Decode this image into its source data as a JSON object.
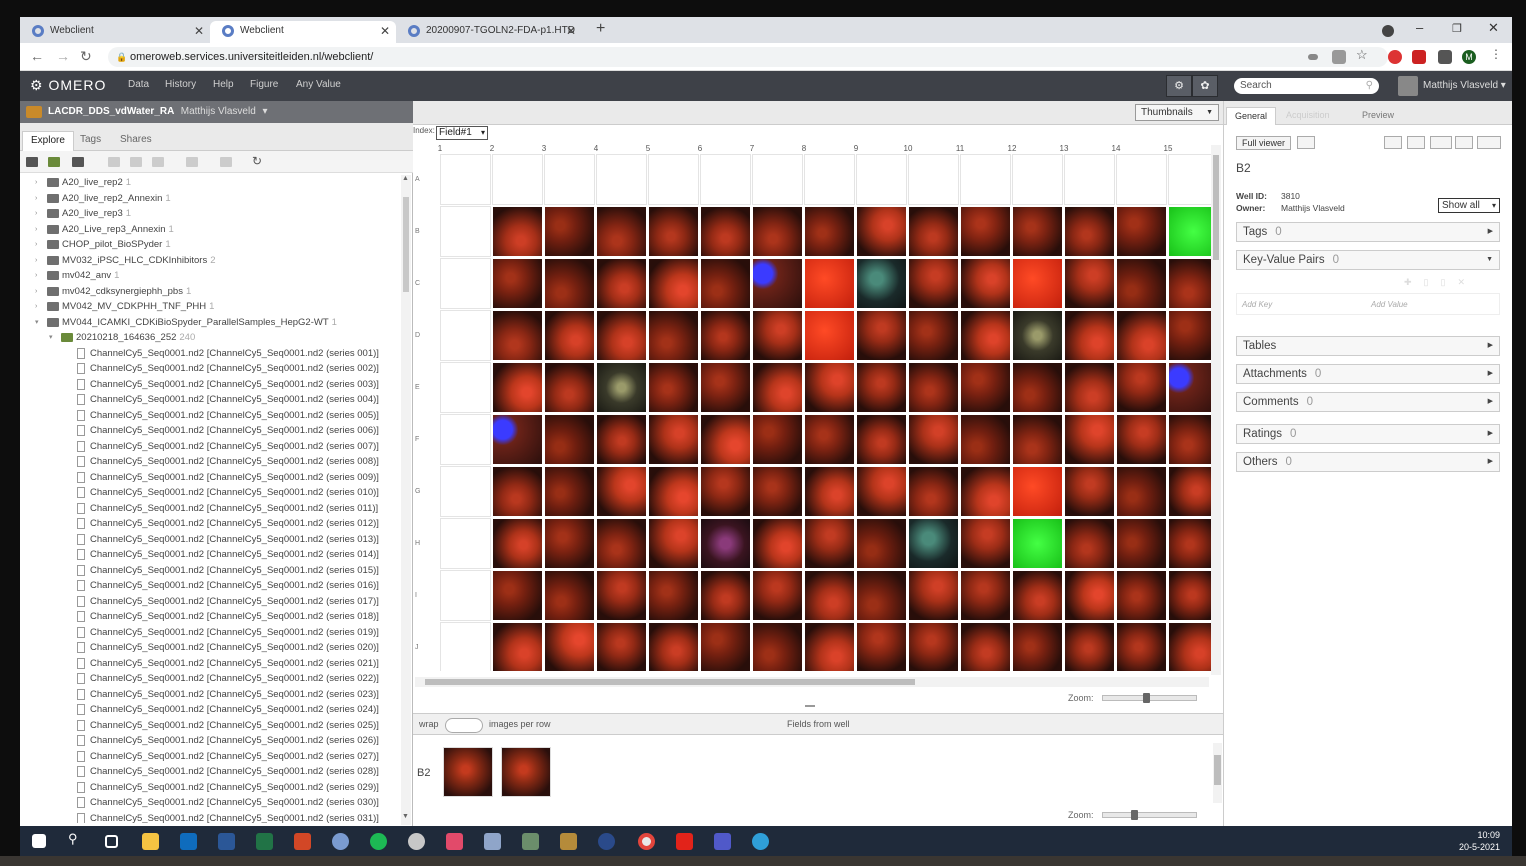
{
  "browser": {
    "tabs": [
      {
        "title": "Webclient",
        "active": false
      },
      {
        "title": "Webclient",
        "active": true
      },
      {
        "title": "20200907-TGOLN2-FDA-p1.HTD",
        "active": false
      }
    ],
    "url": "omeroweb.services.universiteitleiden.nl/webclient/"
  },
  "app": {
    "logo": "OMERO",
    "menu": [
      "Data",
      "History",
      "Help",
      "Figure",
      "Any Value"
    ],
    "search_placeholder": "Search",
    "user": "Matthijs Vlasveld"
  },
  "left": {
    "group": "LACDR_DDS_vdWater_RA",
    "group_user": "Matthijs Vlasveld",
    "tabs": [
      "Explore",
      "Tags",
      "Shares"
    ],
    "projects": [
      {
        "name": "A20_live_rep2",
        "count": "1"
      },
      {
        "name": "A20_live_rep2_Annexin",
        "count": "1"
      },
      {
        "name": "A20_live_rep3",
        "count": "1"
      },
      {
        "name": "A20_Live_rep3_Annexin",
        "count": "1"
      },
      {
        "name": "CHOP_pilot_BioSPyder",
        "count": "1"
      },
      {
        "name": "MV032_iPSC_HLC_CDKInhibitors",
        "count": "2"
      },
      {
        "name": "mv042_anv",
        "count": "1"
      },
      {
        "name": "mv042_cdksynergiephh_pbs",
        "count": "1"
      },
      {
        "name": "MV042_MV_CDKPHH_TNF_PHH",
        "count": "1"
      },
      {
        "name": "MV044_ICAMKI_CDKiBioSpyder_ParallelSamples_HepG2-WT",
        "count": "1"
      }
    ],
    "dataset": {
      "name": "20210218_164636_252",
      "count": "240"
    },
    "images": [
      "ChannelCy5_Seq0001.nd2 [ChannelCy5_Seq0001.nd2 (series 001)]",
      "ChannelCy5_Seq0001.nd2 [ChannelCy5_Seq0001.nd2 (series 002)]",
      "ChannelCy5_Seq0001.nd2 [ChannelCy5_Seq0001.nd2 (series 003)]",
      "ChannelCy5_Seq0001.nd2 [ChannelCy5_Seq0001.nd2 (series 004)]",
      "ChannelCy5_Seq0001.nd2 [ChannelCy5_Seq0001.nd2 (series 005)]",
      "ChannelCy5_Seq0001.nd2 [ChannelCy5_Seq0001.nd2 (series 006)]",
      "ChannelCy5_Seq0001.nd2 [ChannelCy5_Seq0001.nd2 (series 007)]",
      "ChannelCy5_Seq0001.nd2 [ChannelCy5_Seq0001.nd2 (series 008)]",
      "ChannelCy5_Seq0001.nd2 [ChannelCy5_Seq0001.nd2 (series 009)]",
      "ChannelCy5_Seq0001.nd2 [ChannelCy5_Seq0001.nd2 (series 010)]",
      "ChannelCy5_Seq0001.nd2 [ChannelCy5_Seq0001.nd2 (series 011)]",
      "ChannelCy5_Seq0001.nd2 [ChannelCy5_Seq0001.nd2 (series 012)]",
      "ChannelCy5_Seq0001.nd2 [ChannelCy5_Seq0001.nd2 (series 013)]",
      "ChannelCy5_Seq0001.nd2 [ChannelCy5_Seq0001.nd2 (series 014)]",
      "ChannelCy5_Seq0001.nd2 [ChannelCy5_Seq0001.nd2 (series 015)]",
      "ChannelCy5_Seq0001.nd2 [ChannelCy5_Seq0001.nd2 (series 016)]",
      "ChannelCy5_Seq0001.nd2 [ChannelCy5_Seq0001.nd2 (series 017)]",
      "ChannelCy5_Seq0001.nd2 [ChannelCy5_Seq0001.nd2 (series 018)]",
      "ChannelCy5_Seq0001.nd2 [ChannelCy5_Seq0001.nd2 (series 019)]",
      "ChannelCy5_Seq0001.nd2 [ChannelCy5_Seq0001.nd2 (series 020)]",
      "ChannelCy5_Seq0001.nd2 [ChannelCy5_Seq0001.nd2 (series 021)]",
      "ChannelCy5_Seq0001.nd2 [ChannelCy5_Seq0001.nd2 (series 022)]",
      "ChannelCy5_Seq0001.nd2 [ChannelCy5_Seq0001.nd2 (series 023)]",
      "ChannelCy5_Seq0001.nd2 [ChannelCy5_Seq0001.nd2 (series 024)]",
      "ChannelCy5_Seq0001.nd2 [ChannelCy5_Seq0001.nd2 (series 025)]",
      "ChannelCy5_Seq0001.nd2 [ChannelCy5_Seq0001.nd2 (series 026)]",
      "ChannelCy5_Seq0001.nd2 [ChannelCy5_Seq0001.nd2 (series 027)]",
      "ChannelCy5_Seq0001.nd2 [ChannelCy5_Seq0001.nd2 (series 028)]",
      "ChannelCy5_Seq0001.nd2 [ChannelCy5_Seq0001.nd2 (series 029)]",
      "ChannelCy5_Seq0001.nd2 [ChannelCy5_Seq0001.nd2 (series 030)]",
      "ChannelCy5_Seq0001.nd2 [ChannelCy5_Seq0001.nd2 (series 031)]"
    ]
  },
  "center": {
    "view_select": "Thumbnails",
    "index_label": "Index:",
    "field_select": "Field#1",
    "columns": [
      "1",
      "2",
      "3",
      "4",
      "5",
      "6",
      "7",
      "8",
      "9",
      "10",
      "11",
      "12",
      "13",
      "14",
      "15"
    ],
    "rows": [
      "A",
      "B",
      "C",
      "D",
      "E",
      "F",
      "G",
      "H",
      "I",
      "J"
    ],
    "zoom_label": "Zoom:",
    "wrap_label": "wrap",
    "images_per_row": "images per row",
    "fields_from_well": "Fields from well",
    "well_label": "B2",
    "field_thumbs": 2
  },
  "right": {
    "tabs": [
      "General",
      "Acquisition",
      "Preview"
    ],
    "full_viewer": "Full viewer",
    "well_name": "B2",
    "well_id_label": "Well ID:",
    "well_id": "3810",
    "owner_label": "Owner:",
    "owner": "Matthijs Vlasveld",
    "show_all": "Show all",
    "add_key": "Add Key",
    "add_value": "Add Value",
    "sections": [
      {
        "name": "Tags",
        "count": "0"
      },
      {
        "name": "Key-Value Pairs",
        "count": "0"
      },
      {
        "name": "Tables",
        "count": ""
      },
      {
        "name": "Attachments",
        "count": "0"
      },
      {
        "name": "Comments",
        "count": "0"
      },
      {
        "name": "Ratings",
        "count": "0"
      },
      {
        "name": "Others",
        "count": "0"
      }
    ]
  },
  "taskbar": {
    "time": "10:09",
    "date": "20-5-2021"
  },
  "colors": {
    "appbar": "#3e4148",
    "well_red": "#8a2a14",
    "well_bright_red": "#e8301a",
    "well_green": "#22dd22"
  }
}
